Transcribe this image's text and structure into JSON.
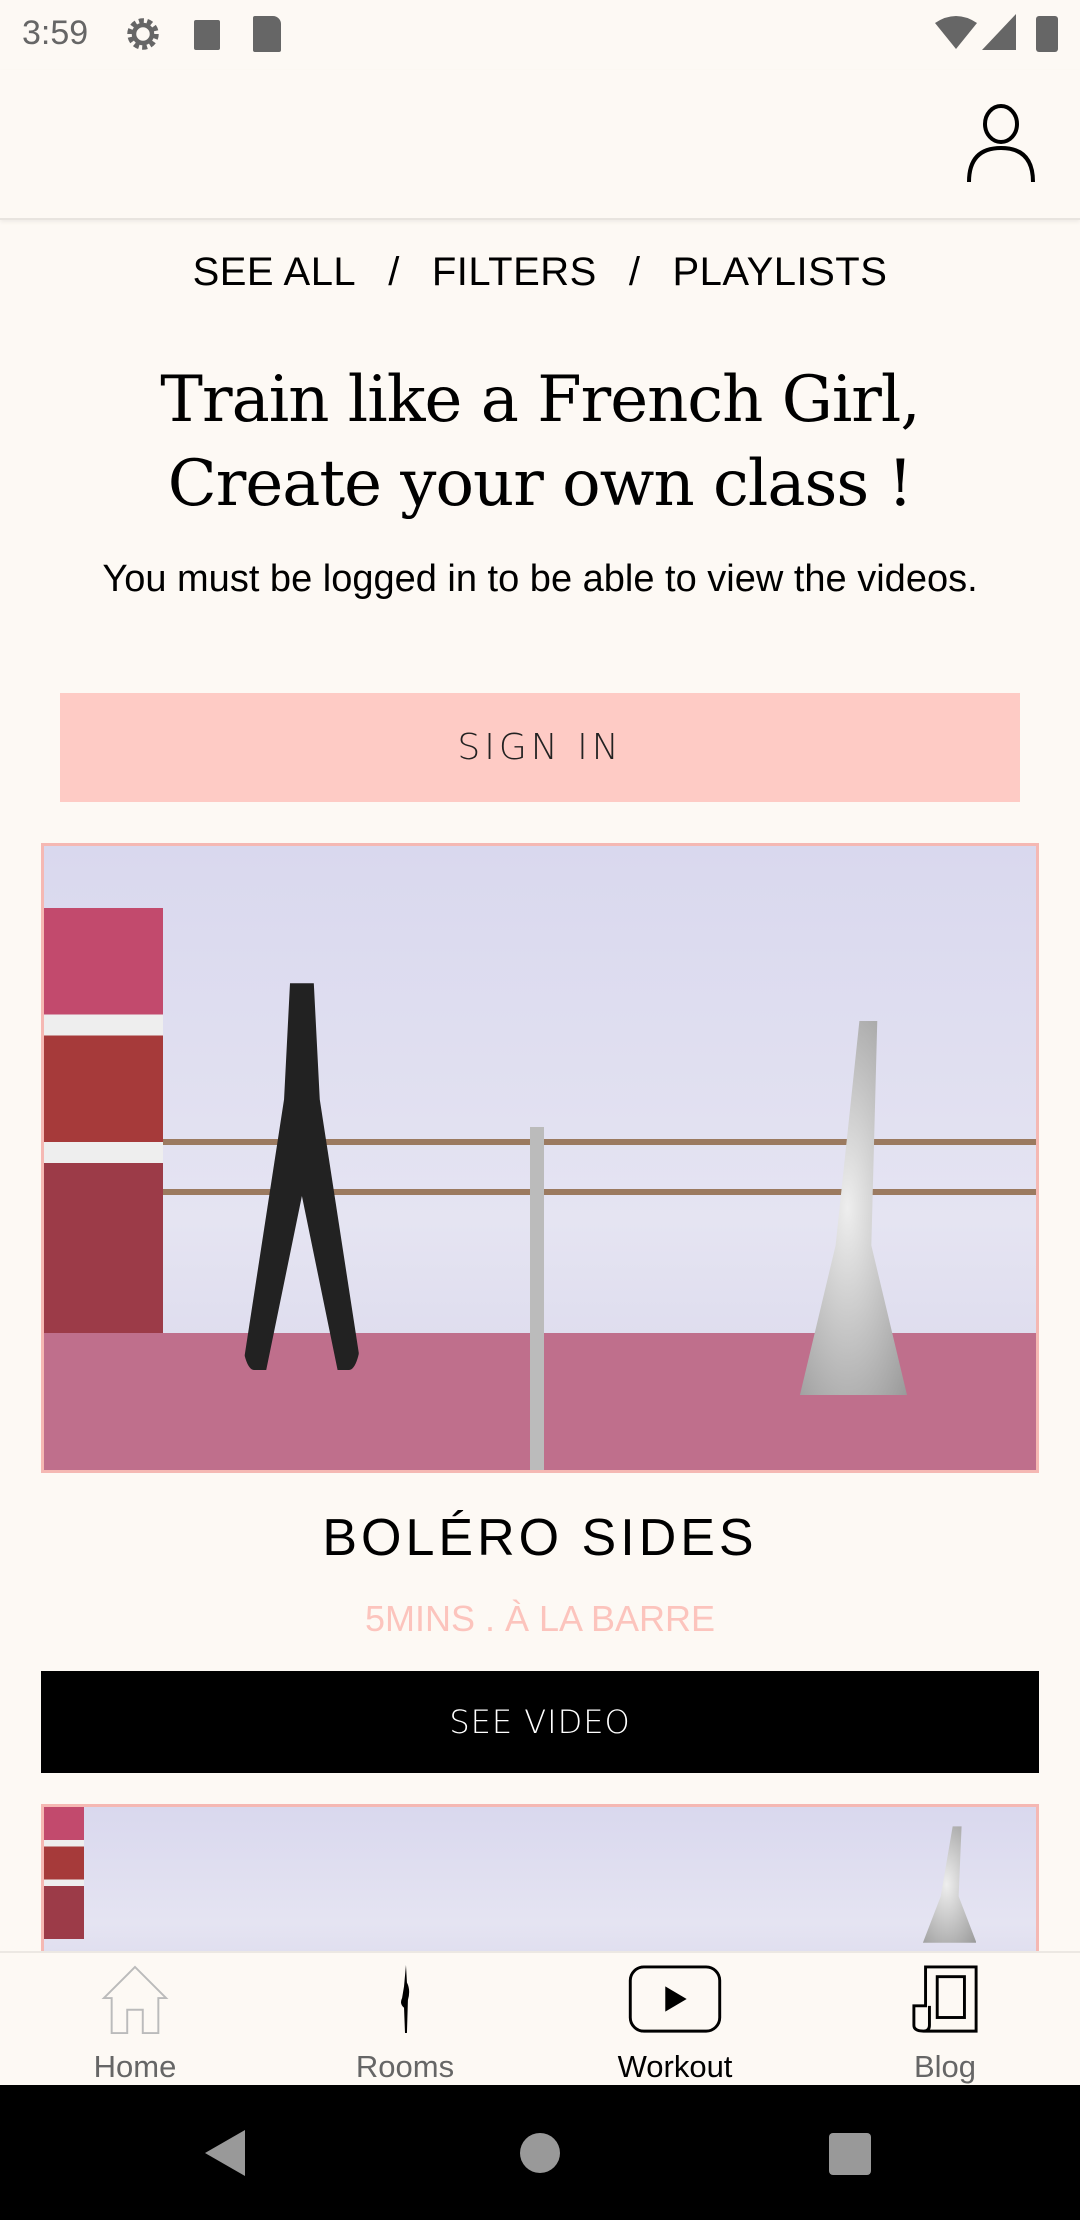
{
  "status_bar": {
    "time": "3:59",
    "icons": [
      "gear-icon",
      "a-icon",
      "sd-card-icon",
      "wifi-icon",
      "signal-icon",
      "battery-icon"
    ]
  },
  "header": {
    "profile_icon": "user-icon"
  },
  "breadcrumbs": {
    "see_all": "SEE ALL",
    "sep": "/",
    "filters": "FILTERS",
    "playlists": "PLAYLISTS"
  },
  "hero": {
    "title": "Train like a French Girl, Create your own class !",
    "subtitle": "You must be logged in to be able to view the videos.",
    "sign_in": "SIGN IN"
  },
  "cards": [
    {
      "title": "BOLÉRO SIDES",
      "meta": "5MINS . À LA BARRE",
      "button": "SEE VIDEO"
    }
  ],
  "bottom_nav": {
    "items": [
      {
        "label": "Home",
        "icon": "home-icon"
      },
      {
        "label": "Rooms",
        "icon": "dancer-icon"
      },
      {
        "label": "Workout",
        "icon": "play-icon",
        "active": true
      },
      {
        "label": "Blog",
        "icon": "scroll-icon"
      }
    ]
  },
  "colors": {
    "background": "#fdf9f4",
    "sign_in": "#fecbc5",
    "accent_pink": "#fcc4bd",
    "button_dark": "#000000"
  }
}
